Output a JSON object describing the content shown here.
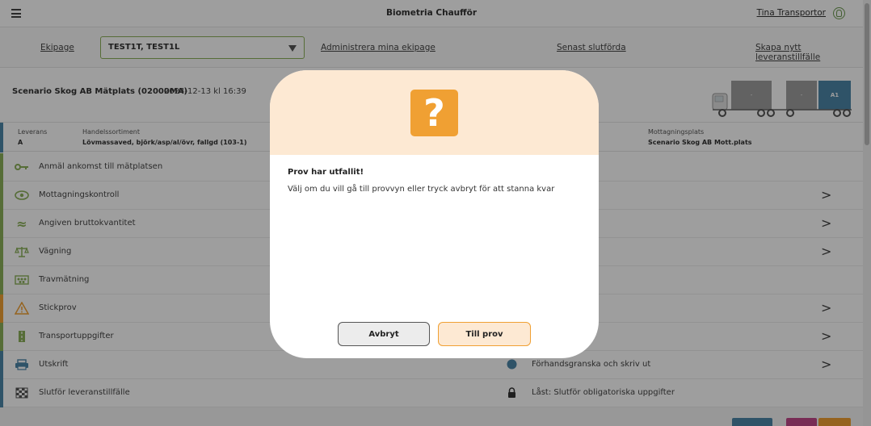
{
  "header": {
    "app_title": "Biometria Chaufför",
    "user_name": "Tina Transportor"
  },
  "nav": {
    "ekipage_label": "Ekipage",
    "selected_vehicle": "TEST1T, TEST1L",
    "administrate_link": "Administrera mina ekipage",
    "recent_link": "Senast slutförda",
    "create_link": "Skapa nytt leveranstillfälle"
  },
  "info": {
    "site_name": "Scenario Skog AB Mätplats (02000MA)",
    "datetime": "2024-12-13 kl 16:39",
    "truck_labels": [
      "-",
      "-",
      "A1"
    ]
  },
  "details": {
    "leverans_label": "Leverans",
    "leverans_value": "A",
    "sortiment_label": "Handelssortiment",
    "sortiment_value": "Lövmassaved, björk/asp/al/övr, fallgd (103-1)",
    "mottagning_label": "Mottagningsplats",
    "mottagning_value": "Scenario Skog AB Mott.plats"
  },
  "tasks": [
    {
      "label": "Anmäl ankomst till mätplatsen",
      "icon": "key-icon",
      "stripe": "#8cb05a"
    },
    {
      "label": "Mottagningskontroll",
      "icon": "eye-icon",
      "stripe": "#8cb05a"
    },
    {
      "label": "Angiven bruttokvantitet",
      "icon": "approx-icon",
      "stripe": "#8cb05a"
    },
    {
      "label": "Vägning",
      "icon": "scale-icon",
      "stripe": "#8cb05a"
    },
    {
      "label": "Travmätning",
      "icon": "timber-stack-icon",
      "stripe": "#8cb05a"
    },
    {
      "label": "Stickprov",
      "icon": "warning-icon",
      "stripe": "#f0a033"
    },
    {
      "label": "Transportuppgifter",
      "icon": "road-icon",
      "stripe": "#8cb05a"
    },
    {
      "label": "Utskrift",
      "icon": "printer-icon",
      "stripe": "#4c86a8"
    },
    {
      "label": "Slutför leveranstillfälle",
      "icon": "checkered-flag-icon",
      "stripe": "#4c86a8"
    }
  ],
  "right_tasks": {
    "preview": "Förhandsgranska och skriv ut",
    "locked": "Låst: Slutför obligatoriska uppgifter"
  },
  "modal": {
    "icon_text": "?",
    "title": "Prov har utfallit!",
    "message": "Välj om du vill gå till provvyn eller tryck avbryt för att stanna kvar",
    "cancel_label": "Avbryt",
    "confirm_label": "Till prov"
  },
  "colors": {
    "accent_green": "#8cb05a",
    "accent_orange": "#f0a033",
    "accent_blue": "#4c86a8"
  }
}
